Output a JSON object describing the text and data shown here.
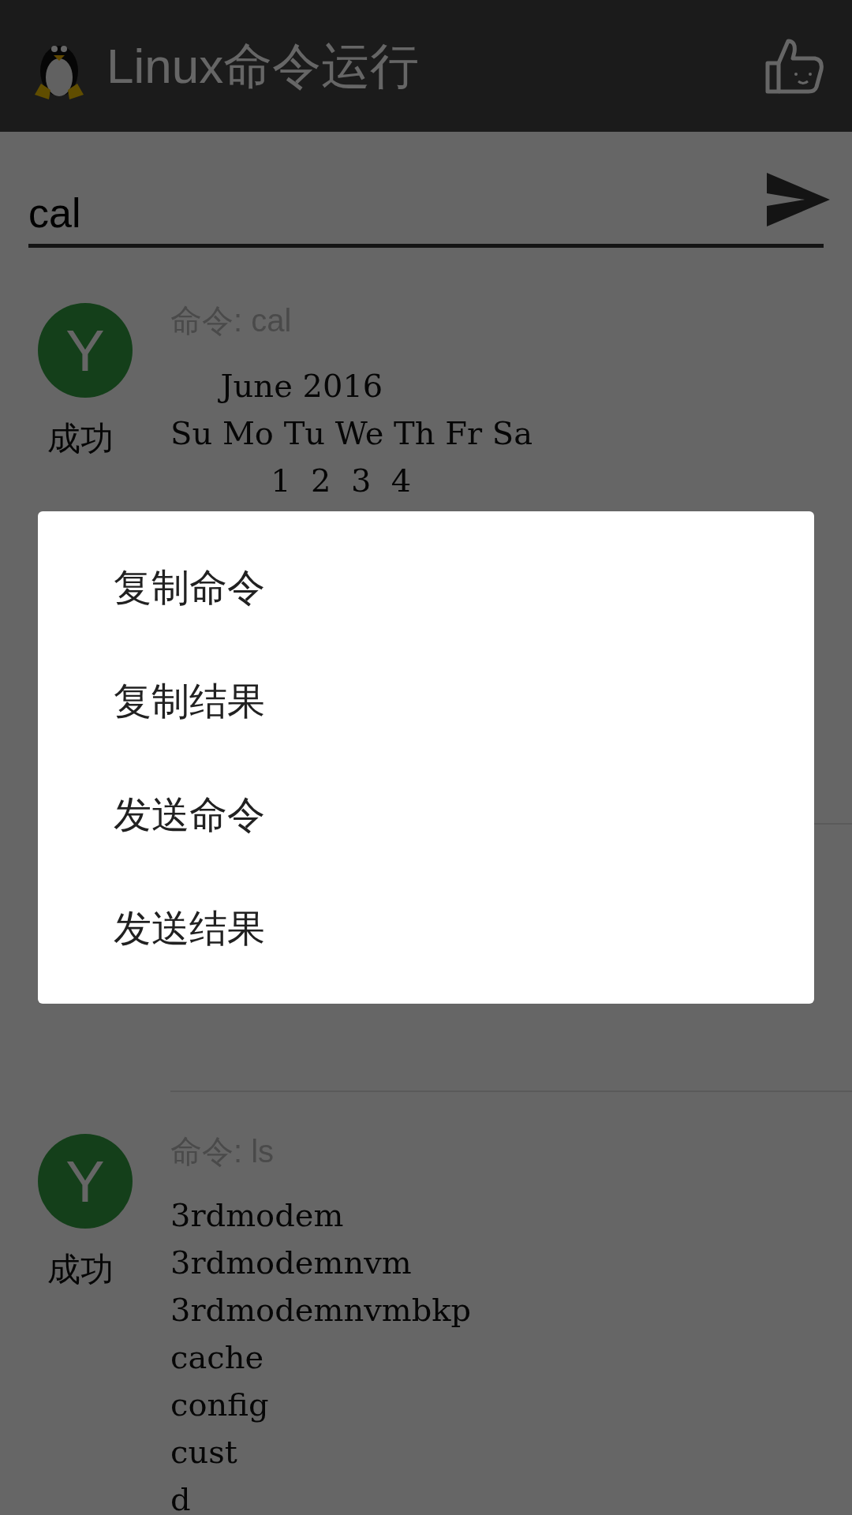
{
  "app_bar": {
    "title": "Linux命令运行"
  },
  "command_input": {
    "value": "cal"
  },
  "results": [
    {
      "kind": "success",
      "avatar": "Y",
      "status": "成功",
      "command": "命令: cal",
      "output": [
        "     June 2016",
        "Su Mo Tu We Th Fr Sa",
        "          1  2  3  4"
      ]
    },
    {
      "kind": "success",
      "avatar": "Y",
      "status": "成功",
      "command": "命令: ls",
      "output": [
        "3rdmodem",
        "3rdmodemnvm",
        "3rdmodemnvmbkp",
        "cache",
        "config",
        "cust",
        "d"
      ]
    }
  ],
  "menu": {
    "items": [
      "复制命令",
      "复制结果",
      "发送命令",
      "发送结果"
    ]
  }
}
